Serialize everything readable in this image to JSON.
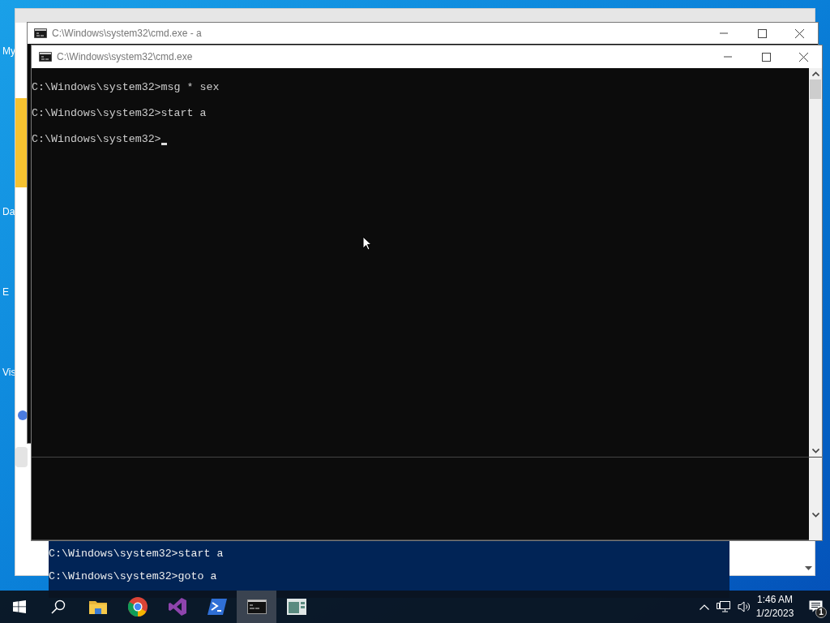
{
  "desktop": {
    "icon_labels": [
      "My",
      "Da",
      "E",
      "Vis"
    ]
  },
  "windows": [
    {
      "title": "C:\\Windows\\system32\\cmd.exe - a"
    },
    {
      "title": "C:\\Windows\\system32\\cmd.exe",
      "lines": [
        "C:\\Windows\\system32>msg * sex",
        "C:\\Windows\\system32>start a",
        "C:\\Windows\\system32>"
      ],
      "cursor": true
    }
  ],
  "blue_console": {
    "lines": [
      "C:\\Windows\\system32>start a",
      "C:\\Windows\\system32>goto a"
    ]
  },
  "taskbar": {
    "apps": [
      {
        "kind": "folder",
        "selected": false
      },
      {
        "kind": "browser",
        "selected": false
      },
      {
        "kind": "studio",
        "selected": false
      },
      {
        "kind": "shell",
        "selected": false
      },
      {
        "kind": "console",
        "selected": true
      },
      {
        "kind": "window",
        "selected": false
      }
    ],
    "time": "1:46 AM",
    "date": "1/2/2023",
    "notifications": "1"
  }
}
